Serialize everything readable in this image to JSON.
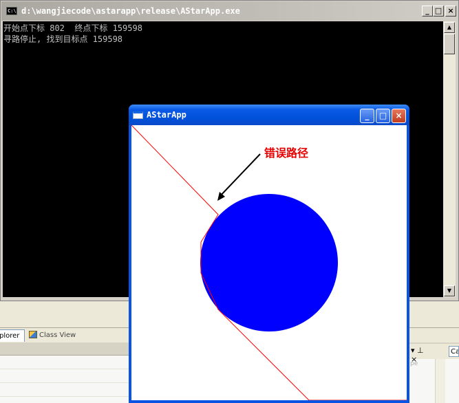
{
  "console": {
    "title": "d:\\wangjiecode\\astarapp\\release\\AStarApp.exe",
    "icon_text": "C:\\",
    "lines": [
      "开始点下标 802  终点下标 159598",
      "寻路停止, 找到目标点 159598"
    ],
    "controls": {
      "minimize": "_",
      "maximize": "□",
      "close": "×"
    }
  },
  "astar_window": {
    "title": "AStarApp",
    "annotation": "错误路径",
    "colors": {
      "circle": "#0000ff",
      "path": "#ff0000",
      "annotation": "#e60000",
      "arrow": "#000000"
    },
    "controls": {
      "minimize": "_",
      "maximize": "□",
      "close": "×"
    }
  },
  "ide": {
    "tabs": {
      "solution_explorer": "plorer",
      "class_view": "Class View"
    },
    "right_panel": {
      "pin": "▾ ⊥ ×",
      "cat": "Ca",
      "type_label": "pe"
    }
  }
}
